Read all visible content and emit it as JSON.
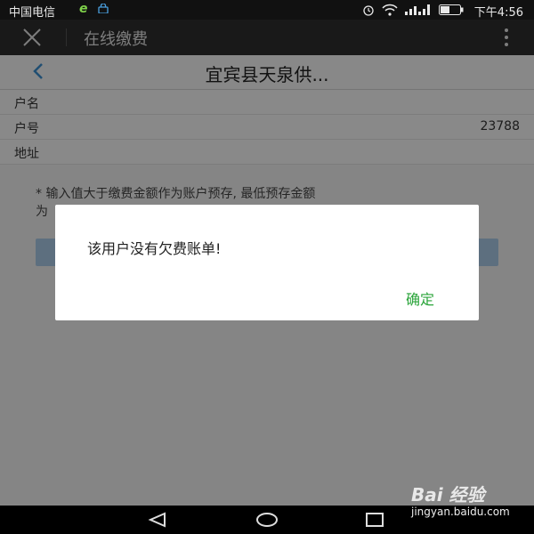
{
  "status_bar": {
    "carrier": "中国电信",
    "time": "下午4:56",
    "icons": [
      "e-icon",
      "lock-icon",
      "alarm-icon",
      "wifi-icon",
      "signal-icon",
      "battery-icon"
    ]
  },
  "titlebar": {
    "title": "在线缴费",
    "close_icon": "close-icon",
    "more_icon": "more-vertical-icon"
  },
  "page": {
    "header_title": "宜宾县天泉供...",
    "rows": [
      {
        "label": "户名",
        "value": ""
      },
      {
        "label": "户号",
        "value": "23788"
      },
      {
        "label": "地址",
        "value": ""
      }
    ],
    "note_line1": "* 输入值大于缴费金额作为账户预存, 最低预存金额",
    "note_line2": "为"
  },
  "dialog": {
    "message": "该用户没有欠费账单!",
    "ok_label": "确定"
  },
  "navbar": {
    "icons": [
      "back-triangle-icon",
      "home-circle-icon",
      "recent-square-icon"
    ]
  },
  "watermark": {
    "brand": "Bai 经验",
    "url": "jingyan.baidu.com"
  },
  "colors": {
    "accent_green": "#2aa43a",
    "back_arrow_blue": "#3b8fd0",
    "pay_button": "#a9cbe8"
  }
}
